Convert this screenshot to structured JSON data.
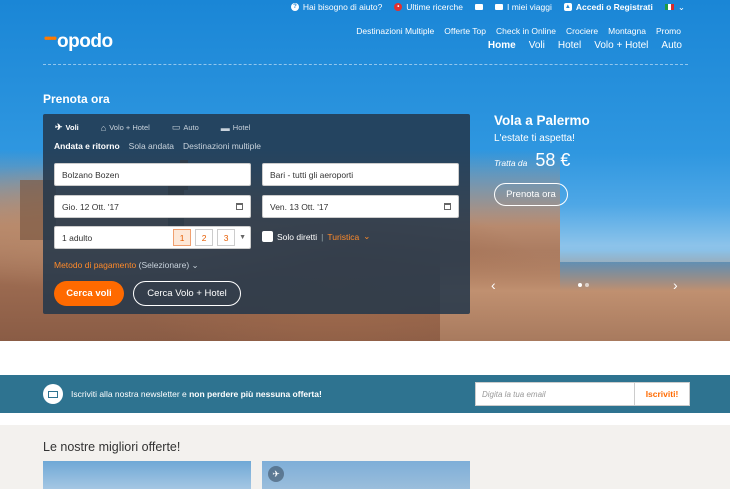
{
  "topbar": {
    "help": "Hai bisogno di aiuto?",
    "recent": "Ultime ricerche",
    "trips": "I miei viaggi",
    "login": "Accedi o Registrati"
  },
  "brand": {
    "name": "opodo",
    "accent": "#ff6a00"
  },
  "nav": {
    "secondary": [
      "Destinazioni Multiple",
      "Offerte Top",
      "Check in Online",
      "Crociere",
      "Montagna",
      "Promo"
    ],
    "main": [
      "Home",
      "Voli",
      "Hotel",
      "Volo + Hotel",
      "Auto"
    ]
  },
  "search": {
    "heading": "Prenota ora",
    "tabs": [
      "Voli",
      "Volo + Hotel",
      "Auto",
      "Hotel"
    ],
    "trip_types": [
      "Andata e ritorno",
      "Sola andata",
      "Destinazioni multiple"
    ],
    "from": "Bolzano Bozen",
    "to": "Bari - tutti gli aeroporti",
    "depart": "Gio. 12 Ott. '17",
    "return": "Ven. 13 Ott. '17",
    "passengers": "1 adulto",
    "pax_options": [
      "1",
      "2",
      "3"
    ],
    "direct_label": "Solo diretti",
    "class_label": "Turistica",
    "payment_label": "Metodo di pagamento",
    "payment_select": "(Selezionare)",
    "btn_search": "Cerca voli",
    "btn_package": "Cerca Volo + Hotel"
  },
  "promo": {
    "title": "Vola a Palermo",
    "subtitle": "L'estate ti aspetta!",
    "price_label": "Tratta da",
    "price": "58 €",
    "button": "Prenota ora"
  },
  "newsletter": {
    "text_a": "Iscriviti alla nostra newsletter e ",
    "text_b": "non perdere più nessuna offerta!",
    "placeholder": "Digita la tua email",
    "button": "Iscriviti!"
  },
  "offers": {
    "heading": "Le nostre migliori offerte!"
  }
}
